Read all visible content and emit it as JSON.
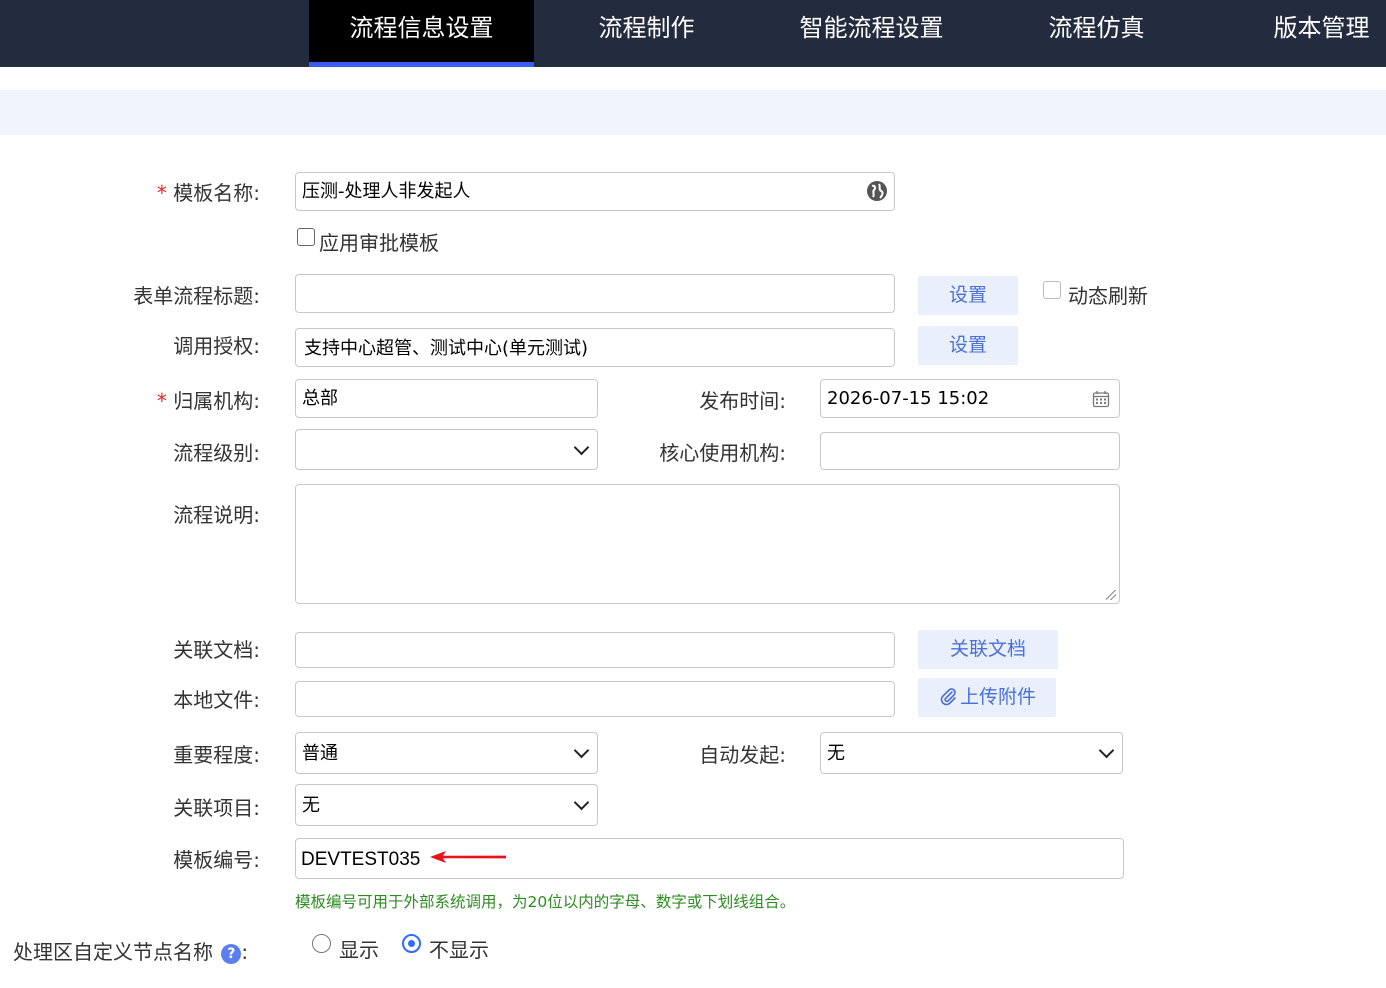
{
  "nav": {
    "tabs": [
      {
        "label": "流程信息设置"
      },
      {
        "label": "流程制作"
      },
      {
        "label": "智能流程设置"
      },
      {
        "label": "流程仿真"
      },
      {
        "label": "版本管理"
      }
    ]
  },
  "form": {
    "required_mark": "*",
    "template_name": {
      "label": "模板名称:",
      "value": "压测-处理人非发起人",
      "icon": "globe-icon"
    },
    "apply_approval_template": {
      "label": "应用审批模板",
      "checked": false
    },
    "form_flow_title": {
      "label": "表单流程标题:",
      "value": "",
      "button": "设置"
    },
    "dynamic_refresh": {
      "label": "动态刷新",
      "checked": false
    },
    "call_authorization": {
      "label": "调用授权:",
      "value": "支持中心超管、测试中心(单元测试)",
      "button": "设置"
    },
    "owner_org": {
      "label": "归属机构:",
      "value": "总部"
    },
    "publish_time": {
      "label": "发布时间:",
      "value": "2026-07-15 15:02",
      "icon": "calendar-icon"
    },
    "flow_level": {
      "label": "流程级别:",
      "value": ""
    },
    "core_org": {
      "label": "核心使用机构:",
      "value": ""
    },
    "flow_desc": {
      "label": "流程说明:",
      "value": ""
    },
    "related_docs": {
      "label": "关联文档:",
      "value": "",
      "button": "关联文档"
    },
    "local_file": {
      "label": "本地文件:",
      "value": "",
      "button": "上传附件",
      "icon": "paperclip-icon"
    },
    "importance": {
      "label": "重要程度:",
      "value": "普通"
    },
    "auto_start": {
      "label": "自动发起:",
      "value": "无"
    },
    "related_project": {
      "label": "关联项目:",
      "value": "无"
    },
    "template_code": {
      "label": "模板编号:",
      "value": "DEVTEST035",
      "hint": "模板编号可用于外部系统调用，为20位以内的字母、数字或下划线组合。"
    },
    "custom_node_name": {
      "label": "处理区自定义节点名称",
      "colon": ":",
      "help_icon": "?",
      "options": [
        {
          "label": "显示",
          "selected": false
        },
        {
          "label": "不显示",
          "selected": true
        }
      ]
    }
  },
  "colors": {
    "nav_bg": "#232b3e",
    "nav_active_bg": "#000000",
    "nav_active_underline": "#3a5cf0",
    "band_bg": "#f0f4fc",
    "button_bg": "#e9f0fb",
    "button_text": "#4a6fd8",
    "required": "#e02424",
    "hint_text": "#2e8b22",
    "radio_selected": "#2f6bff",
    "annotation_arrow": "#e8141c"
  }
}
